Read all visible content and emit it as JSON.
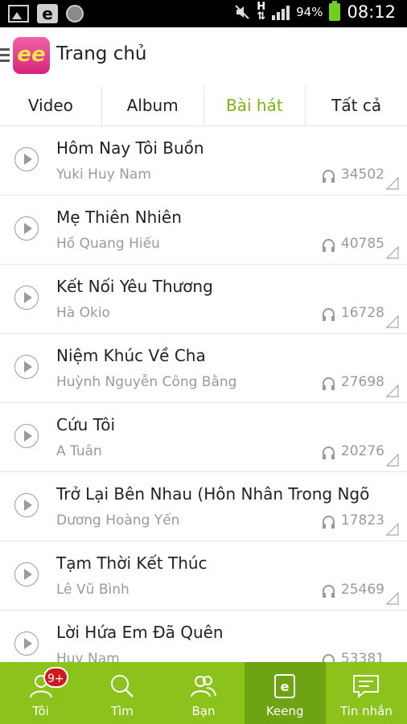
{
  "status_bar": {
    "battery": "94%",
    "time": "08:12",
    "network": "H"
  },
  "app_bar": {
    "logo_text": "ee",
    "title": "Trang chủ"
  },
  "tabs": [
    {
      "label": "Video",
      "active": false
    },
    {
      "label": "Album",
      "active": false
    },
    {
      "label": "Bài hát",
      "active": true
    },
    {
      "label": "Tất cả",
      "active": false
    }
  ],
  "songs": [
    {
      "title": "Hôm Nay Tôi Buồn",
      "artist": "Yuki Huy Nam",
      "listens": "34502"
    },
    {
      "title": "Mẹ Thiên Nhiên",
      "artist": "Hồ Quang Hiếu",
      "listens": "40785"
    },
    {
      "title": "Kết Nối Yêu Thương",
      "artist": "Hà Okio",
      "listens": "16728"
    },
    {
      "title": "Niệm Khúc Về Cha",
      "artist": "Huỳnh Nguyễn Công Bằng",
      "listens": "27698"
    },
    {
      "title": "Cứu Tôi",
      "artist": "A Tuân",
      "listens": "20276"
    },
    {
      "title": "Trở Lại Bên Nhau (Hôn Nhân Trong Ngõ",
      "artist": "Dương Hoàng Yến",
      "listens": "17823"
    },
    {
      "title": "Tạm Thời Kết Thúc",
      "artist": "Lê Vũ Bình",
      "listens": "25469"
    },
    {
      "title": "Lời Hứa Em Đã Quên",
      "artist": "Huy Nam",
      "listens": "53381"
    }
  ],
  "bottom_nav": {
    "items": [
      {
        "label": "Tôi",
        "icon": "person-icon",
        "badge": "9+"
      },
      {
        "label": "Tìm",
        "icon": "search-icon"
      },
      {
        "label": "Bạn",
        "icon": "friends-icon"
      },
      {
        "label": "Keeng",
        "icon": "keeng-icon",
        "active": true
      },
      {
        "label": "Tin nhắn",
        "icon": "message-icon"
      }
    ]
  },
  "colors": {
    "accent": "#7fb317",
    "nav_bg": "#8bc21c",
    "nav_active": "#6ea414",
    "badge": "#d0191e"
  }
}
